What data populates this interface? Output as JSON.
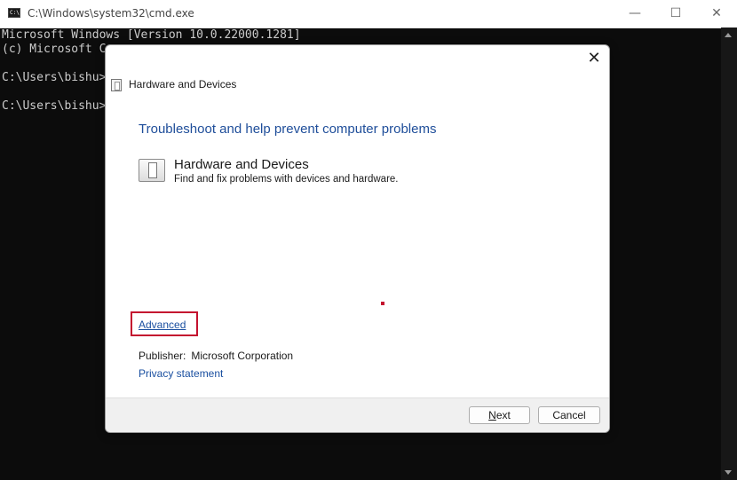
{
  "cmd": {
    "title": "C:\\Windows\\system32\\cmd.exe",
    "icon_label": "C:\\",
    "lines": [
      "Microsoft Windows [Version 10.0.22000.1281]",
      "(c) Microsoft C",
      "",
      "C:\\Users\\bishu>",
      "",
      "C:\\Users\\bishu>"
    ],
    "controls": {
      "minimize": "—",
      "maximize": "☐",
      "close": "✕"
    }
  },
  "dialog": {
    "title": "Hardware and Devices",
    "close": "✕",
    "heading": "Troubleshoot and help prevent computer problems",
    "item": {
      "title": "Hardware and Devices",
      "description": "Find and fix problems with devices and hardware.",
      "icon": "hardware-devices-icon"
    },
    "advanced_link": "Advanced",
    "publisher_label": "Publisher:",
    "publisher_value": "Microsoft Corporation",
    "privacy_link": "Privacy statement",
    "buttons": {
      "next_accel": "N",
      "next_rest": "ext",
      "cancel": "Cancel"
    }
  },
  "colors": {
    "highlight": "#c4122f",
    "link": "#1a4fa0",
    "heading": "#1f4e9a",
    "console_bg": "#0c0c0c"
  }
}
